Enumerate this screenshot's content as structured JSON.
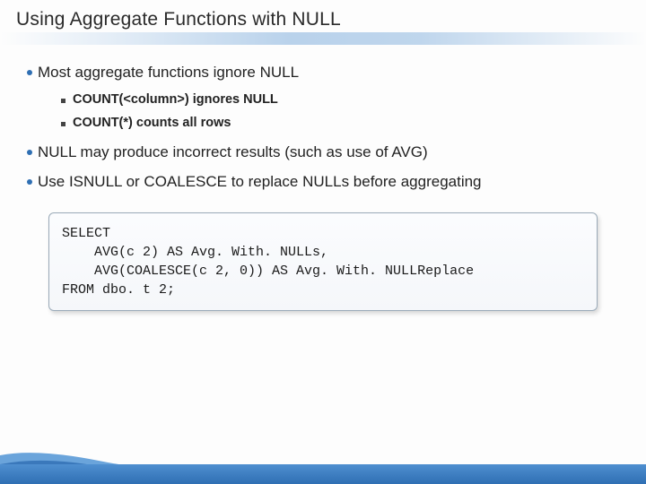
{
  "title": "Using Aggregate Functions with NULL",
  "bullets": {
    "b1": "Most aggregate functions ignore NULL",
    "s1": "COUNT(<column>) ignores NULL",
    "s2": "COUNT(*) counts all rows",
    "b2": "NULL may produce incorrect results (such as use of AVG)",
    "b3": "Use ISNULL or COALESCE to replace NULLs before aggregating"
  },
  "code": "SELECT\n    AVG(c 2) AS Avg. With. NULLs,\n    AVG(COALESCE(c 2, 0)) AS Avg. With. NULLReplace\nFROM dbo. t 2;"
}
